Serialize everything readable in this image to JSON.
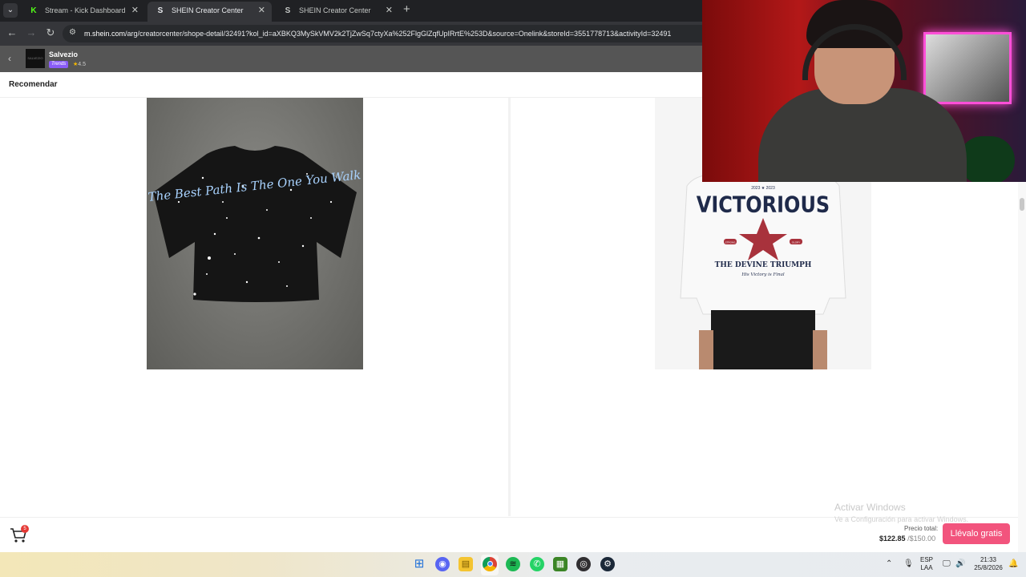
{
  "browser": {
    "tabs": [
      {
        "title": "Stream - Kick Dashboard",
        "favicon": "K",
        "favicon_color": "#53fc18",
        "active": false
      },
      {
        "title": "SHEIN Creator Center",
        "favicon": "S",
        "favicon_color": "#ffffff",
        "active": true
      },
      {
        "title": "SHEIN Creator Center",
        "favicon": "S",
        "favicon_color": "#ffffff",
        "active": false
      }
    ],
    "new_tab_icon": "plus-icon",
    "url_domain": "m.shein.com",
    "url_path": "/arg/creatorcenter/shope-detail/32491?kol_id=aXBKQ3MySkVMV2k2TjZwSq7ctyXa%252FlgGlZqfUpIRrtE%253D&source=Onelink&storeId=3551778713&activityId=32491"
  },
  "store": {
    "name": "Salvezio",
    "logo_text": "SALVEZIO",
    "badge": "Trends",
    "rating": "4.5"
  },
  "section": {
    "title": "Recomendar"
  },
  "products": [
    {
      "type": "tshirt",
      "print_text": "The Best Path Is The One You Walk",
      "color": "#151515"
    },
    {
      "type": "sweatshirt",
      "top_text": "2023 ★ 2023",
      "headline": "VICTORIOUS",
      "left_badge": "STRONG",
      "right_badge": "GLORY",
      "subline": "THE DEVINE TRIUMPH",
      "script_line": "His Victory is Final",
      "color": "#f4f4f4"
    }
  ],
  "cart": {
    "count": "5"
  },
  "windows_watermark": {
    "line1": "Activar Windows",
    "line2": "Ve a Configuración para activar Windows."
  },
  "checkout": {
    "price_label": "Precio total:",
    "price_now": "$122.85",
    "price_was": "/$150.00",
    "cta_label": "Llévalo gratis",
    "cta_color": "#f2547d"
  },
  "taskbar": {
    "language_top": "ESP",
    "language_bottom": "LAA",
    "time": "21:33",
    "date": "25/8/2026",
    "pinned": [
      "windows-start-icon",
      "discord-icon",
      "file-explorer-icon",
      "chrome-icon",
      "spotify-icon",
      "whatsapp-icon",
      "minecraft-icon",
      "obs-icon",
      "steam-icon"
    ]
  }
}
